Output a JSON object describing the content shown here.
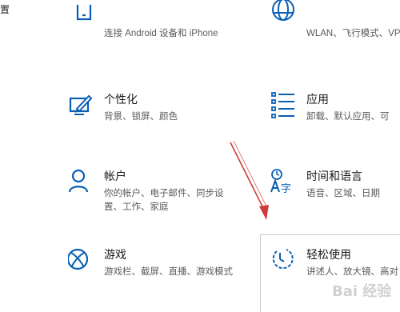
{
  "edge_glyph": "置",
  "colors": {
    "accent": "#0a5fb4",
    "arrow": "#d23a3a",
    "title": "#1a1a1a",
    "description": "#5b5b5b"
  },
  "tiles": [
    {
      "id": "phone",
      "icon": "phone-icon",
      "title": "",
      "description": [
        "连接 Android 设备和 iPhone"
      ]
    },
    {
      "id": "network",
      "icon": "globe-icon",
      "title": "",
      "description": [
        "WLAN、飞行模式、VP"
      ]
    },
    {
      "id": "personalization",
      "icon": "pen-tablet-icon",
      "title": "个性化",
      "description": [
        "背景、锁屏、颜色"
      ]
    },
    {
      "id": "apps",
      "icon": "apps-list-icon",
      "title": "应用",
      "description": [
        "卸载、默认应用、可"
      ]
    },
    {
      "id": "accounts",
      "icon": "person-icon",
      "title": "帐户",
      "description": [
        "你的帐户、电子邮件、同步设",
        "置、工作、家庭"
      ]
    },
    {
      "id": "time-language",
      "icon": "time-language-icon",
      "title": "时间和语言",
      "description": [
        "语音、区域、日期"
      ]
    },
    {
      "id": "gaming",
      "icon": "xbox-icon",
      "title": "游戏",
      "description": [
        "游戏栏、截屏、直播、游戏模式"
      ]
    },
    {
      "id": "ease-of-access",
      "icon": "ease-of-access-icon",
      "title": "轻松使用",
      "description": [
        "讲述人、放大镜、高对"
      ]
    }
  ],
  "watermark": "Bai 经验"
}
